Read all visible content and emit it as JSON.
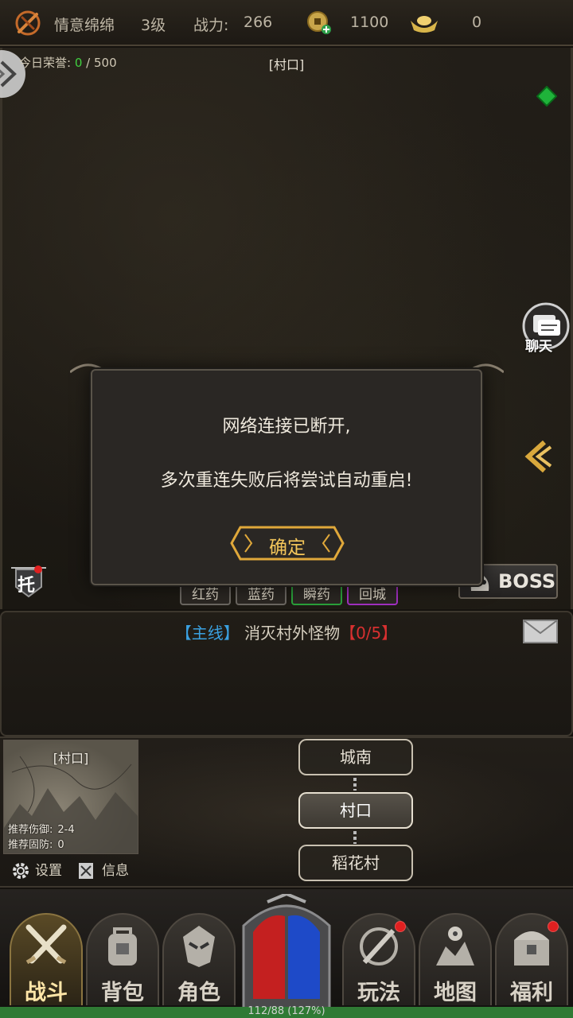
{
  "topbar": {
    "player_name": "情意绵绵",
    "level": "3级",
    "power_label": "战力:",
    "power_value": "266",
    "coins": "1100",
    "ingots": "0"
  },
  "honor": {
    "label": "今日荣誉:",
    "current": "0",
    "separator": " / ",
    "max": "500"
  },
  "location_title": "[村口]",
  "chat_label": "聊天",
  "auto_label": "托",
  "boss_label": "BOSS",
  "potions": [
    "红药",
    "蓝药",
    "瞬药",
    "回城"
  ],
  "dialog": {
    "line1": "网络连接已断开,",
    "line2": "多次重连失败后将尝试自动重启!",
    "confirm": "确定"
  },
  "quest": {
    "tag_open": "【",
    "tag": "主线",
    "tag_close": "】",
    "title": "消灭村外怪物",
    "progress": "【0/5】"
  },
  "minimap": {
    "title": "[村口]",
    "rec_attack_label": "推荐伤御:",
    "rec_attack_value": "2-4",
    "rec_defense_label": "推荐固防:",
    "rec_defense_value": "0"
  },
  "tools": {
    "settings": "设置",
    "info": "信息"
  },
  "nav_nodes": [
    "城南",
    "村口",
    "稻花村"
  ],
  "tabs": [
    "战斗",
    "背包",
    "角色",
    "玩法",
    "地图",
    "福利"
  ],
  "xp": {
    "text": "112/88 (127%)",
    "fraction": 1.0
  },
  "colors": {
    "accent_gold": "#f4c65a",
    "quest_blue": "#3aa0e0",
    "quest_red": "#d83030",
    "honor_green": "#40d040"
  }
}
